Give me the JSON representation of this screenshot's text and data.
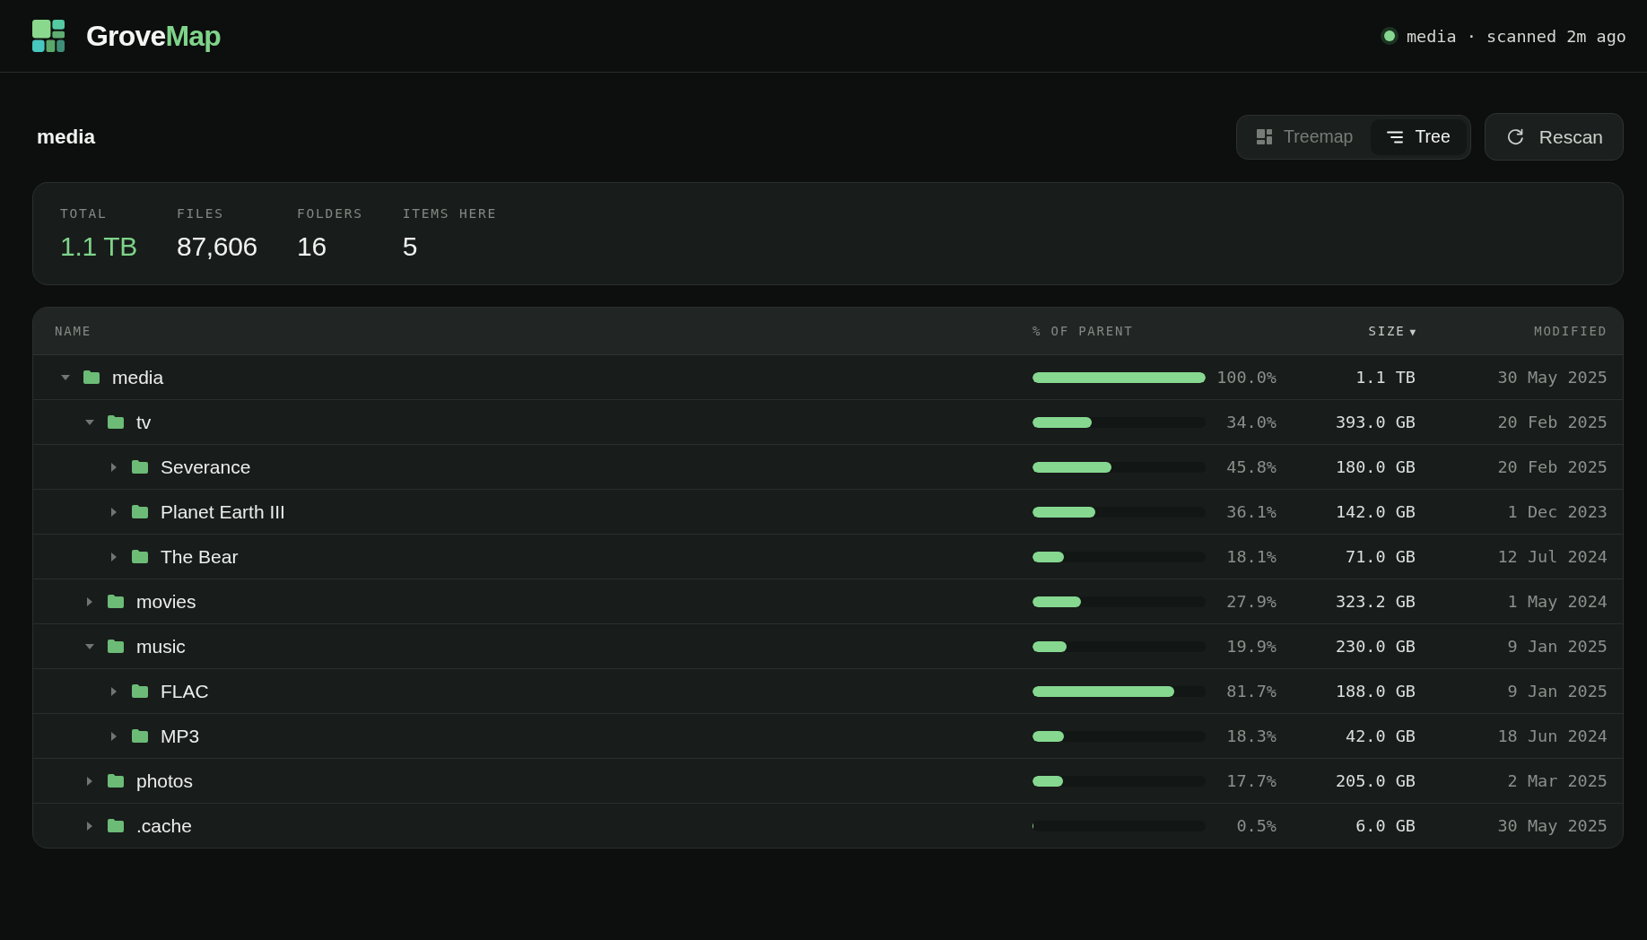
{
  "app": {
    "name_start": "Grove",
    "name_end": "Map",
    "status": "media · scanned 2m ago"
  },
  "page": {
    "title": "media"
  },
  "view_toggle": [
    {
      "kind": "treemap",
      "label": "Treemap",
      "selected": false
    },
    {
      "kind": "tree",
      "label": "Tree",
      "selected": true
    }
  ],
  "rescan_button": {
    "label": "Rescan"
  },
  "stats": [
    {
      "label": "TOTAL",
      "value": "1.1 TB",
      "accent": true
    },
    {
      "label": "FILES",
      "value": "87,606",
      "accent": false
    },
    {
      "label": "FOLDERS",
      "value": "16",
      "accent": false
    },
    {
      "label": "ITEMS HERE",
      "value": "5",
      "accent": false
    }
  ],
  "table": {
    "columns": [
      {
        "label": "NAME",
        "sorted": false
      },
      {
        "label": "% OF PARENT",
        "sorted": false
      },
      {
        "label": "SIZE",
        "sorted": true,
        "sort_indicator": "▼"
      },
      {
        "label": "MODIFIED",
        "sorted": false
      }
    ],
    "rows": [
      {
        "name": "media",
        "expanded": true,
        "level": 1,
        "percent": "100.0%",
        "size": "1.1 TB",
        "modified": "30 May 2025",
        "children": [
          {
            "name": "tv",
            "expanded": true,
            "level": 0.34,
            "percent": "34.0%",
            "size": "393.0 GB",
            "modified": "20 Feb 2025",
            "children": [
              {
                "name": "Severance",
                "expanded": false,
                "level": 0.458,
                "percent": "45.8%",
                "size": "180.0 GB",
                "modified": "20 Feb 2025"
              },
              {
                "name": "Planet Earth III",
                "expanded": false,
                "level": 0.361,
                "percent": "36.1%",
                "size": "142.0 GB",
                "modified": "1 Dec 2023"
              },
              {
                "name": "The Bear",
                "expanded": false,
                "level": 0.181,
                "percent": "18.1%",
                "size": "71.0 GB",
                "modified": "12 Jul 2024"
              }
            ]
          },
          {
            "name": "movies",
            "expanded": false,
            "level": 0.279,
            "percent": "27.9%",
            "size": "323.2 GB",
            "modified": "1 May 2024"
          },
          {
            "name": "music",
            "expanded": true,
            "level": 0.199,
            "percent": "19.9%",
            "size": "230.0 GB",
            "modified": "9 Jan 2025",
            "children": [
              {
                "name": "FLAC",
                "expanded": false,
                "level": 0.817,
                "percent": "81.7%",
                "size": "188.0 GB",
                "modified": "9 Jan 2025"
              },
              {
                "name": "MP3",
                "expanded": false,
                "level": 0.183,
                "percent": "18.3%",
                "size": "42.0 GB",
                "modified": "18 Jun 2024"
              }
            ]
          },
          {
            "name": "photos",
            "expanded": false,
            "level": 0.177,
            "percent": "17.7%",
            "size": "205.0 GB",
            "modified": "2 Mar 2025"
          },
          {
            "name": ".cache",
            "expanded": false,
            "level": 0.005,
            "percent": "0.5%",
            "size": "6.0 GB",
            "modified": "30 May 2025"
          }
        ]
      }
    ]
  }
}
